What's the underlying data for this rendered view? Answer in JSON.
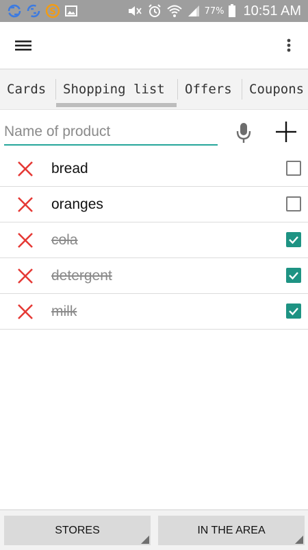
{
  "status_bar": {
    "time": "10:51 AM",
    "battery": "77%",
    "left_icons": [
      "sync-icon",
      "sync-icon",
      "s-app-icon",
      "image-icon"
    ],
    "right_icons": [
      "mute-icon",
      "alarm-icon",
      "wifi-icon",
      "signal-icon",
      "battery-icon"
    ]
  },
  "app_bar": {
    "menu_icon": "hamburger-menu-icon",
    "overflow_icon": "more-vert-icon"
  },
  "tabs": [
    {
      "label": "Cards"
    },
    {
      "label": "Shopping list",
      "selected": true
    },
    {
      "label": "Offers"
    },
    {
      "label": "Coupons"
    }
  ],
  "input": {
    "placeholder": "Name of product",
    "value": "",
    "mic_icon": "microphone-icon",
    "add_icon": "plus-icon"
  },
  "items": [
    {
      "label": "bread",
      "checked": false
    },
    {
      "label": "oranges",
      "checked": false
    },
    {
      "label": "cola",
      "checked": true
    },
    {
      "label": "detergent",
      "checked": true
    },
    {
      "label": "milk",
      "checked": true
    }
  ],
  "bottom_buttons": {
    "stores": "STORES",
    "in_area": "IN THE AREA"
  },
  "colors": {
    "accent": "#26a69a",
    "checkbox_on": "#1e9383",
    "delete": "#e53935",
    "status_bar": "#9e9e9e"
  }
}
